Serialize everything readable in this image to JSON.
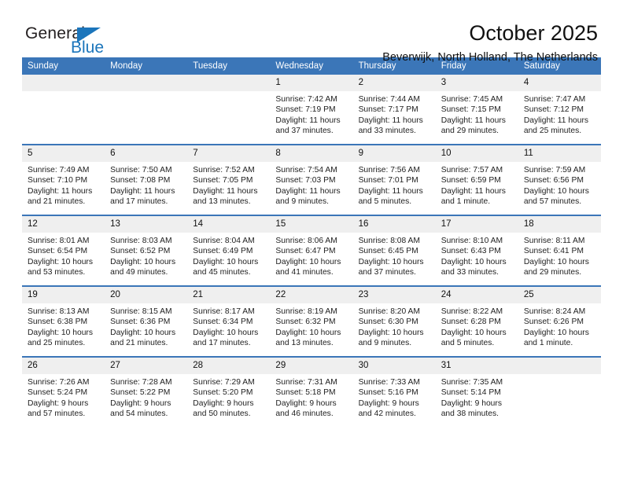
{
  "brand": {
    "name_top": "General",
    "name_bottom": "Blue",
    "triangle_color": "#1b75bb"
  },
  "header": {
    "month_title": "October 2025",
    "location": "Beverwijk, North Holland, The Netherlands"
  },
  "theme": {
    "header_blue": "#3b76b8",
    "daynum_gray": "#efefef",
    "text": "#111111"
  },
  "weekdays": [
    "Sunday",
    "Monday",
    "Tuesday",
    "Wednesday",
    "Thursday",
    "Friday",
    "Saturday"
  ],
  "labels": {
    "sunrise_prefix": "Sunrise:",
    "sunset_prefix": "Sunset:",
    "daylight_prefix": "Daylight:"
  },
  "weeks": [
    [
      {
        "day": "",
        "sunrise": "",
        "sunset": "",
        "daylight_line1": "",
        "daylight_line2": ""
      },
      {
        "day": "",
        "sunrise": "",
        "sunset": "",
        "daylight_line1": "",
        "daylight_line2": ""
      },
      {
        "day": "",
        "sunrise": "",
        "sunset": "",
        "daylight_line1": "",
        "daylight_line2": ""
      },
      {
        "day": "1",
        "sunrise": "Sunrise: 7:42 AM",
        "sunset": "Sunset: 7:19 PM",
        "daylight_line1": "Daylight: 11 hours",
        "daylight_line2": "and 37 minutes."
      },
      {
        "day": "2",
        "sunrise": "Sunrise: 7:44 AM",
        "sunset": "Sunset: 7:17 PM",
        "daylight_line1": "Daylight: 11 hours",
        "daylight_line2": "and 33 minutes."
      },
      {
        "day": "3",
        "sunrise": "Sunrise: 7:45 AM",
        "sunset": "Sunset: 7:15 PM",
        "daylight_line1": "Daylight: 11 hours",
        "daylight_line2": "and 29 minutes."
      },
      {
        "day": "4",
        "sunrise": "Sunrise: 7:47 AM",
        "sunset": "Sunset: 7:12 PM",
        "daylight_line1": "Daylight: 11 hours",
        "daylight_line2": "and 25 minutes."
      }
    ],
    [
      {
        "day": "5",
        "sunrise": "Sunrise: 7:49 AM",
        "sunset": "Sunset: 7:10 PM",
        "daylight_line1": "Daylight: 11 hours",
        "daylight_line2": "and 21 minutes."
      },
      {
        "day": "6",
        "sunrise": "Sunrise: 7:50 AM",
        "sunset": "Sunset: 7:08 PM",
        "daylight_line1": "Daylight: 11 hours",
        "daylight_line2": "and 17 minutes."
      },
      {
        "day": "7",
        "sunrise": "Sunrise: 7:52 AM",
        "sunset": "Sunset: 7:05 PM",
        "daylight_line1": "Daylight: 11 hours",
        "daylight_line2": "and 13 minutes."
      },
      {
        "day": "8",
        "sunrise": "Sunrise: 7:54 AM",
        "sunset": "Sunset: 7:03 PM",
        "daylight_line1": "Daylight: 11 hours",
        "daylight_line2": "and 9 minutes."
      },
      {
        "day": "9",
        "sunrise": "Sunrise: 7:56 AM",
        "sunset": "Sunset: 7:01 PM",
        "daylight_line1": "Daylight: 11 hours",
        "daylight_line2": "and 5 minutes."
      },
      {
        "day": "10",
        "sunrise": "Sunrise: 7:57 AM",
        "sunset": "Sunset: 6:59 PM",
        "daylight_line1": "Daylight: 11 hours",
        "daylight_line2": "and 1 minute."
      },
      {
        "day": "11",
        "sunrise": "Sunrise: 7:59 AM",
        "sunset": "Sunset: 6:56 PM",
        "daylight_line1": "Daylight: 10 hours",
        "daylight_line2": "and 57 minutes."
      }
    ],
    [
      {
        "day": "12",
        "sunrise": "Sunrise: 8:01 AM",
        "sunset": "Sunset: 6:54 PM",
        "daylight_line1": "Daylight: 10 hours",
        "daylight_line2": "and 53 minutes."
      },
      {
        "day": "13",
        "sunrise": "Sunrise: 8:03 AM",
        "sunset": "Sunset: 6:52 PM",
        "daylight_line1": "Daylight: 10 hours",
        "daylight_line2": "and 49 minutes."
      },
      {
        "day": "14",
        "sunrise": "Sunrise: 8:04 AM",
        "sunset": "Sunset: 6:49 PM",
        "daylight_line1": "Daylight: 10 hours",
        "daylight_line2": "and 45 minutes."
      },
      {
        "day": "15",
        "sunrise": "Sunrise: 8:06 AM",
        "sunset": "Sunset: 6:47 PM",
        "daylight_line1": "Daylight: 10 hours",
        "daylight_line2": "and 41 minutes."
      },
      {
        "day": "16",
        "sunrise": "Sunrise: 8:08 AM",
        "sunset": "Sunset: 6:45 PM",
        "daylight_line1": "Daylight: 10 hours",
        "daylight_line2": "and 37 minutes."
      },
      {
        "day": "17",
        "sunrise": "Sunrise: 8:10 AM",
        "sunset": "Sunset: 6:43 PM",
        "daylight_line1": "Daylight: 10 hours",
        "daylight_line2": "and 33 minutes."
      },
      {
        "day": "18",
        "sunrise": "Sunrise: 8:11 AM",
        "sunset": "Sunset: 6:41 PM",
        "daylight_line1": "Daylight: 10 hours",
        "daylight_line2": "and 29 minutes."
      }
    ],
    [
      {
        "day": "19",
        "sunrise": "Sunrise: 8:13 AM",
        "sunset": "Sunset: 6:38 PM",
        "daylight_line1": "Daylight: 10 hours",
        "daylight_line2": "and 25 minutes."
      },
      {
        "day": "20",
        "sunrise": "Sunrise: 8:15 AM",
        "sunset": "Sunset: 6:36 PM",
        "daylight_line1": "Daylight: 10 hours",
        "daylight_line2": "and 21 minutes."
      },
      {
        "day": "21",
        "sunrise": "Sunrise: 8:17 AM",
        "sunset": "Sunset: 6:34 PM",
        "daylight_line1": "Daylight: 10 hours",
        "daylight_line2": "and 17 minutes."
      },
      {
        "day": "22",
        "sunrise": "Sunrise: 8:19 AM",
        "sunset": "Sunset: 6:32 PM",
        "daylight_line1": "Daylight: 10 hours",
        "daylight_line2": "and 13 minutes."
      },
      {
        "day": "23",
        "sunrise": "Sunrise: 8:20 AM",
        "sunset": "Sunset: 6:30 PM",
        "daylight_line1": "Daylight: 10 hours",
        "daylight_line2": "and 9 minutes."
      },
      {
        "day": "24",
        "sunrise": "Sunrise: 8:22 AM",
        "sunset": "Sunset: 6:28 PM",
        "daylight_line1": "Daylight: 10 hours",
        "daylight_line2": "and 5 minutes."
      },
      {
        "day": "25",
        "sunrise": "Sunrise: 8:24 AM",
        "sunset": "Sunset: 6:26 PM",
        "daylight_line1": "Daylight: 10 hours",
        "daylight_line2": "and 1 minute."
      }
    ],
    [
      {
        "day": "26",
        "sunrise": "Sunrise: 7:26 AM",
        "sunset": "Sunset: 5:24 PM",
        "daylight_line1": "Daylight: 9 hours",
        "daylight_line2": "and 57 minutes."
      },
      {
        "day": "27",
        "sunrise": "Sunrise: 7:28 AM",
        "sunset": "Sunset: 5:22 PM",
        "daylight_line1": "Daylight: 9 hours",
        "daylight_line2": "and 54 minutes."
      },
      {
        "day": "28",
        "sunrise": "Sunrise: 7:29 AM",
        "sunset": "Sunset: 5:20 PM",
        "daylight_line1": "Daylight: 9 hours",
        "daylight_line2": "and 50 minutes."
      },
      {
        "day": "29",
        "sunrise": "Sunrise: 7:31 AM",
        "sunset": "Sunset: 5:18 PM",
        "daylight_line1": "Daylight: 9 hours",
        "daylight_line2": "and 46 minutes."
      },
      {
        "day": "30",
        "sunrise": "Sunrise: 7:33 AM",
        "sunset": "Sunset: 5:16 PM",
        "daylight_line1": "Daylight: 9 hours",
        "daylight_line2": "and 42 minutes."
      },
      {
        "day": "31",
        "sunrise": "Sunrise: 7:35 AM",
        "sunset": "Sunset: 5:14 PM",
        "daylight_line1": "Daylight: 9 hours",
        "daylight_line2": "and 38 minutes."
      },
      {
        "day": "",
        "sunrise": "",
        "sunset": "",
        "daylight_line1": "",
        "daylight_line2": ""
      }
    ]
  ]
}
